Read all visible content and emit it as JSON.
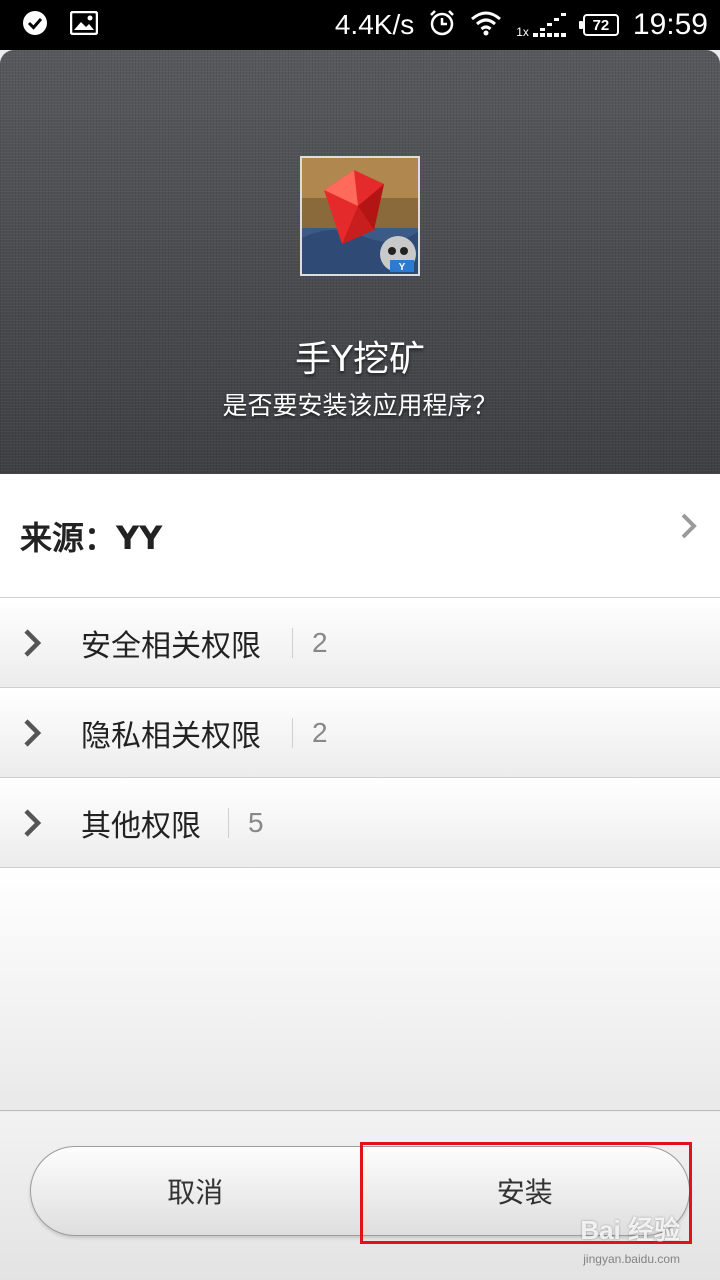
{
  "status_bar": {
    "network_speed": "4.4K/s",
    "battery_level": "72",
    "time": "19:59",
    "signal_prefix": "1x"
  },
  "app": {
    "name": "手Y挖矿",
    "install_question": "是否要安装该应用程序？"
  },
  "source": {
    "label": "来源：YY"
  },
  "permissions": [
    {
      "label": "安全相关权限",
      "count": "2"
    },
    {
      "label": "隐私相关权限",
      "count": "2"
    },
    {
      "label": "其他权限",
      "count": "5"
    }
  ],
  "buttons": {
    "cancel": "取消",
    "install": "安装"
  },
  "watermark": {
    "brand": "Bai 经验",
    "url": "jingyan.baidu.com"
  },
  "colors": {
    "highlight": "#e2121a",
    "header_bg": "#4b4c50"
  }
}
